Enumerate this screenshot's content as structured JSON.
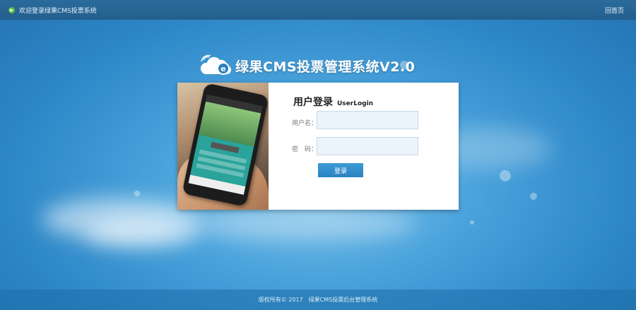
{
  "topbar": {
    "welcome": "欢迎登录绿果CMS投票系统",
    "home_link": "回首页"
  },
  "brand": {
    "title": "绿果CMS投票管理系统V2.0"
  },
  "login": {
    "title_cn": "用户登录",
    "title_en": "UserLogin",
    "username_label": "用户名：",
    "username_value": "",
    "password_label": "密　码：",
    "password_value": "",
    "submit_label": "登录"
  },
  "footer": {
    "copyright": "版权所有© 2017　绿果CMS投票后台管理系统"
  },
  "colors": {
    "accent": "#2b83c2",
    "topbar": "#235f8d",
    "background": "#2d86c6"
  }
}
